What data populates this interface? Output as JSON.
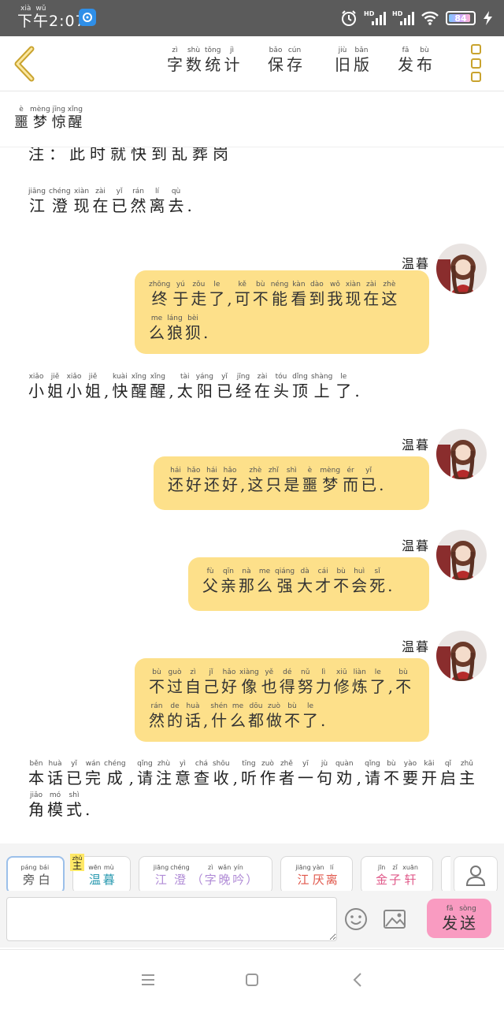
{
  "status": {
    "time_py": [
      "xià",
      "wǔ"
    ],
    "time": "下午2:07",
    "hd1": "HD",
    "hd2": "HD",
    "battery": "84"
  },
  "toolbar": {
    "items": [
      {
        "name": "word-count",
        "chars": [
          [
            "zì",
            "字"
          ],
          [
            "shù",
            "数"
          ],
          [
            "tǒng",
            "统"
          ],
          [
            "jì",
            "计"
          ]
        ]
      },
      {
        "name": "save",
        "chars": [
          [
            "bǎo",
            "保"
          ],
          [
            "cún",
            "存"
          ]
        ]
      },
      {
        "name": "old-version",
        "chars": [
          [
            "jiù",
            "旧"
          ],
          [
            "bǎn",
            "版"
          ]
        ]
      },
      {
        "name": "publish",
        "chars": [
          [
            "fā",
            "发"
          ],
          [
            "bù",
            "布"
          ]
        ]
      }
    ]
  },
  "title": {
    "chars": [
      [
        "è",
        "噩"
      ],
      [
        "mèng",
        "梦"
      ],
      [
        "jīng",
        "惊"
      ],
      [
        "xǐng",
        "醒"
      ]
    ]
  },
  "chat": {
    "cut_text": "注：此时就快到乱葬岗",
    "messages": [
      {
        "type": "narration",
        "chars": [
          [
            "jiāng",
            "江"
          ],
          [
            "chéng",
            "澄"
          ],
          [
            "xiàn",
            "现"
          ],
          [
            "zài",
            "在"
          ],
          [
            "yǐ",
            "已"
          ],
          [
            "rán",
            "然"
          ],
          [
            "lí",
            "离"
          ],
          [
            "qù",
            "去"
          ],
          [
            "",
            "."
          ]
        ]
      },
      {
        "type": "bubble",
        "speaker": [
          [
            "",
            "温"
          ],
          [
            "",
            "暮"
          ]
        ],
        "chars": [
          [
            "zhōng",
            "终"
          ],
          [
            "yú",
            "于"
          ],
          [
            "zǒu",
            "走"
          ],
          [
            "le",
            "了"
          ],
          [
            "",
            ","
          ],
          [
            "kě",
            "可"
          ],
          [
            "bù",
            "不"
          ],
          [
            "néng",
            "能"
          ],
          [
            "kàn",
            "看"
          ],
          [
            "dào",
            "到"
          ],
          [
            "wǒ",
            "我"
          ],
          [
            "xiàn",
            "现"
          ],
          [
            "zài",
            "在"
          ],
          [
            "zhè",
            "这"
          ],
          [
            "me",
            "么"
          ],
          [
            "láng",
            "狼"
          ],
          [
            "bèi",
            "狈"
          ],
          [
            "",
            "."
          ]
        ]
      },
      {
        "type": "narration",
        "chars": [
          [
            "xiǎo",
            "小"
          ],
          [
            "jiě",
            "姐"
          ],
          [
            "xiǎo",
            "小"
          ],
          [
            "jiě",
            "姐"
          ],
          [
            "",
            ","
          ],
          [
            "kuài",
            "快"
          ],
          [
            "xǐng",
            "醒"
          ],
          [
            "xǐng",
            "醒"
          ],
          [
            "",
            ","
          ],
          [
            "tài",
            "太"
          ],
          [
            "yáng",
            "阳"
          ],
          [
            "yǐ",
            "已"
          ],
          [
            "jīng",
            "经"
          ],
          [
            "zài",
            "在"
          ],
          [
            "tóu",
            "头"
          ],
          [
            "dǐng",
            "顶"
          ],
          [
            "shàng",
            "上"
          ],
          [
            "le",
            "了"
          ],
          [
            "",
            "."
          ]
        ]
      },
      {
        "type": "bubble",
        "speaker": [
          [
            "",
            "温"
          ],
          [
            "",
            "暮"
          ]
        ],
        "chars": [
          [
            "hái",
            "还"
          ],
          [
            "hǎo",
            "好"
          ],
          [
            "hái",
            "还"
          ],
          [
            "hǎo",
            "好"
          ],
          [
            "",
            ","
          ],
          [
            "zhè",
            "这"
          ],
          [
            "zhǐ",
            "只"
          ],
          [
            "shì",
            "是"
          ],
          [
            "è",
            "噩"
          ],
          [
            "mèng",
            "梦"
          ],
          [
            "ér",
            "而"
          ],
          [
            "yǐ",
            "已"
          ],
          [
            "",
            "."
          ]
        ]
      },
      {
        "type": "bubble",
        "speaker": [
          [
            "",
            "温"
          ],
          [
            "",
            "暮"
          ]
        ],
        "chars": [
          [
            "fù",
            "父"
          ],
          [
            "qīn",
            "亲"
          ],
          [
            "nà",
            "那"
          ],
          [
            "me",
            "么"
          ],
          [
            "qiáng",
            "强"
          ],
          [
            "dà",
            "大"
          ],
          [
            "cái",
            "才"
          ],
          [
            "bù",
            "不"
          ],
          [
            "huì",
            "会"
          ],
          [
            "sǐ",
            "死"
          ],
          [
            "",
            "."
          ]
        ]
      },
      {
        "type": "bubble",
        "speaker": [
          [
            "",
            "温"
          ],
          [
            "",
            "暮"
          ]
        ],
        "chars": [
          [
            "bù",
            "不"
          ],
          [
            "guò",
            "过"
          ],
          [
            "zì",
            "自"
          ],
          [
            "jǐ",
            "己"
          ],
          [
            "hǎo",
            "好"
          ],
          [
            "xiàng",
            "像"
          ],
          [
            "yě",
            "也"
          ],
          [
            "dé",
            "得"
          ],
          [
            "nǔ",
            "努"
          ],
          [
            "lì",
            "力"
          ],
          [
            "xiū",
            "修"
          ],
          [
            "liàn",
            "炼"
          ],
          [
            "le",
            "了"
          ],
          [
            "",
            ","
          ],
          [
            "bù",
            "不"
          ],
          [
            "rán",
            "然"
          ],
          [
            "de",
            "的"
          ],
          [
            "huà",
            "话"
          ],
          [
            "",
            ","
          ],
          [
            "shén",
            "什"
          ],
          [
            "me",
            "么"
          ],
          [
            "dōu",
            "都"
          ],
          [
            "zuò",
            "做"
          ],
          [
            "bù",
            "不"
          ],
          [
            "le",
            "了"
          ],
          [
            "",
            "."
          ]
        ]
      },
      {
        "type": "narration",
        "chars": [
          [
            "běn",
            "本"
          ],
          [
            "huà",
            "话"
          ],
          [
            "yǐ",
            "已"
          ],
          [
            "wán",
            "完"
          ],
          [
            "chéng",
            "成"
          ],
          [
            "",
            ","
          ],
          [
            "qǐng",
            "请"
          ],
          [
            "zhù",
            "注"
          ],
          [
            "yì",
            "意"
          ],
          [
            "chá",
            "查"
          ],
          [
            "shōu",
            "收"
          ],
          [
            "",
            ","
          ],
          [
            "tīng",
            "听"
          ],
          [
            "zuò",
            "作"
          ],
          [
            "zhě",
            "者"
          ],
          [
            "yī",
            "一"
          ],
          [
            "jù",
            "句"
          ],
          [
            "quàn",
            "劝"
          ],
          [
            "",
            ","
          ],
          [
            "qǐng",
            "请"
          ],
          [
            "bù",
            "不"
          ],
          [
            "yào",
            "要"
          ],
          [
            "kāi",
            "开"
          ],
          [
            "qǐ",
            "启"
          ],
          [
            "zhǔ",
            "主"
          ],
          [
            "jiǎo",
            "角"
          ],
          [
            "mó",
            "模"
          ],
          [
            "shì",
            "式"
          ],
          [
            "",
            "."
          ]
        ]
      }
    ]
  },
  "chips": [
    {
      "name": "narrator",
      "color": "#555555",
      "chars": [
        [
          "páng",
          "旁"
        ],
        [
          "bái",
          "白"
        ]
      ]
    },
    {
      "name": "wenmu",
      "color": "#2a9ab0",
      "badge": [
        "zhǔ",
        "主"
      ],
      "chars": [
        [
          "wēn",
          "温"
        ],
        [
          "mù",
          "暮"
        ]
      ]
    },
    {
      "name": "jiangcheng",
      "color": "#b08bd6",
      "chars": [
        [
          "jiāng",
          "江"
        ],
        [
          "chéng",
          "澄"
        ],
        [
          "",
          "（"
        ],
        [
          "zì",
          "字"
        ],
        [
          "wǎn",
          "晚"
        ],
        [
          "yín",
          "吟"
        ],
        [
          "",
          "）"
        ]
      ]
    },
    {
      "name": "jiangyanli",
      "color": "#e0564a",
      "chars": [
        [
          "jiāng",
          "江"
        ],
        [
          "yàn",
          "厌"
        ],
        [
          "lí",
          "离"
        ]
      ]
    },
    {
      "name": "jinzixuan",
      "color": "#e05a8a",
      "chars": [
        [
          "jīn",
          "金"
        ],
        [
          "zǐ",
          "子"
        ],
        [
          "xuān",
          "轩"
        ]
      ]
    }
  ],
  "input": {
    "placeholder": "",
    "value": ""
  },
  "send": {
    "chars": [
      [
        "fā",
        "发"
      ],
      [
        "sòng",
        "送"
      ]
    ]
  }
}
